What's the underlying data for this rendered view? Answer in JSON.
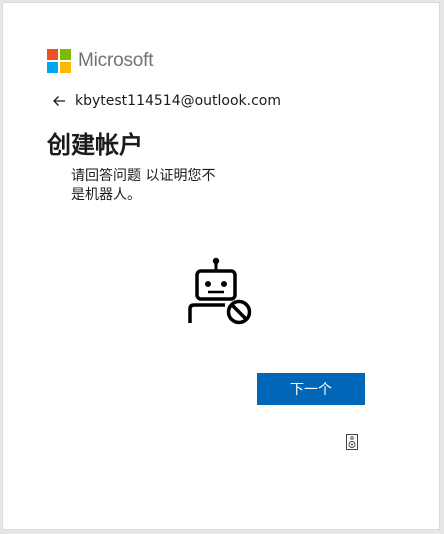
{
  "brand": {
    "name": "Microsoft",
    "colors": [
      "#f25022",
      "#7fba00",
      "#00a4ef",
      "#ffb900"
    ]
  },
  "identity": {
    "email": "kbytest114514@outlook.com",
    "back_icon": "arrow-left-icon"
  },
  "page": {
    "title": "创建帐户",
    "description": "请回答问题 以证明您不是机器人。"
  },
  "illustration": {
    "icon": "robot-blocked-icon"
  },
  "actions": {
    "next_label": "下一个",
    "audio_icon": "speaker-icon"
  },
  "theme": {
    "accent": "#0067b8"
  }
}
